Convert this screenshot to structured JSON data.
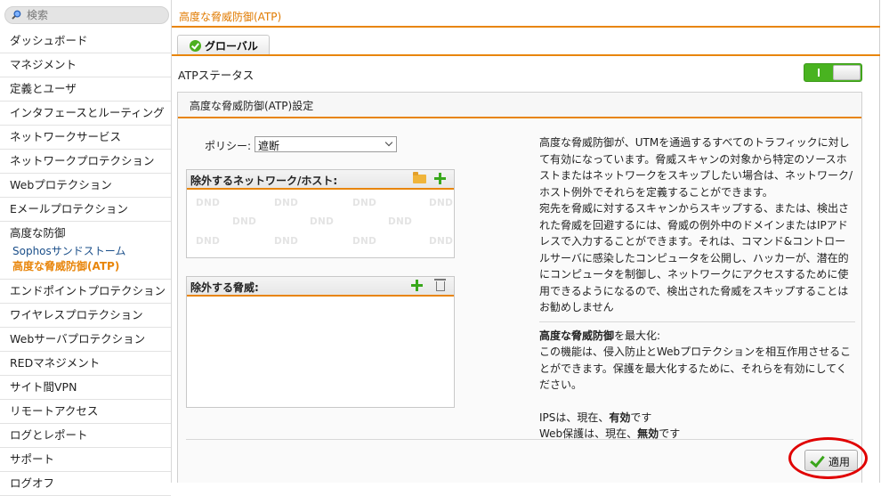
{
  "search": {
    "placeholder": "検索"
  },
  "sidebar": {
    "items_top": [
      "ダッシュボード",
      "マネジメント",
      "定義とユーザ",
      "インタフェースとルーティング",
      "ネットワークサービス",
      "ネットワークプロテクション",
      "Webプロテクション",
      "Eメールプロテクション"
    ],
    "group": {
      "label": "高度な防御",
      "subitems": [
        "Sophosサンドストーム",
        "高度な脅威防御(ATP)"
      ]
    },
    "items_bottom": [
      "エンドポイントプロテクション",
      "ワイヤレスプロテクション",
      "Webサーバプロテクション",
      "REDマネジメント",
      "サイト間VPN",
      "リモートアクセス",
      "ログとレポート",
      "サポート",
      "ログオフ"
    ]
  },
  "header": {
    "title": "高度な脅威防御(ATP)"
  },
  "tab": {
    "label": "グローバル"
  },
  "status": {
    "label": "ATPステータス",
    "enabled": true
  },
  "panel": {
    "title": "高度な脅威防御(ATP)設定",
    "policy_label": "ポリシー:",
    "policy_value": "遮断",
    "exclude_networks_title": "除外するネットワーク/ホスト:",
    "dnd_text": "DND",
    "exclude_threats_title": "除外する脅威:"
  },
  "description": {
    "p1": "高度な脅威防御が、UTMを通過するすべてのトラフィックに対して有効になっています。脅威スキャンの対象から特定のソースホストまたはネットワークをスキップしたい場合は、ネットワーク/ホスト例外でそれらを定義することができます。",
    "p2": "宛先を脅威に対するスキャンからスキップする、または、検出された脅威を回避するには、脅威の例外中のドメインまたはIPアドレスで入力することができます。それは、コマンド&コントロールサーバに感染したコンピュータを公開し、ハッカーが、潜在的にコンピュータを制御し、ネットワークにアクセスするために使用できるようになるので、検出された脅威をスキップすることはお勧めしません",
    "max_heading": "高度な脅威防御",
    "max_heading_suffix": "を最大化:",
    "p3": "この機能は、侵入防止とWebプロテクションを相互作用させることができます。保護を最大化するために、それらを有効にしてください。",
    "ips_prefix": "IPSは、現在、",
    "ips_status": "有効",
    "ips_suffix": "です",
    "web_prefix": "Web保護は、現在、",
    "web_status": "無効",
    "web_suffix": "です"
  },
  "apply_label": "適用",
  "colors": {
    "accent": "#e8850a",
    "on": "#49b320",
    "highlight": "#e00000"
  }
}
